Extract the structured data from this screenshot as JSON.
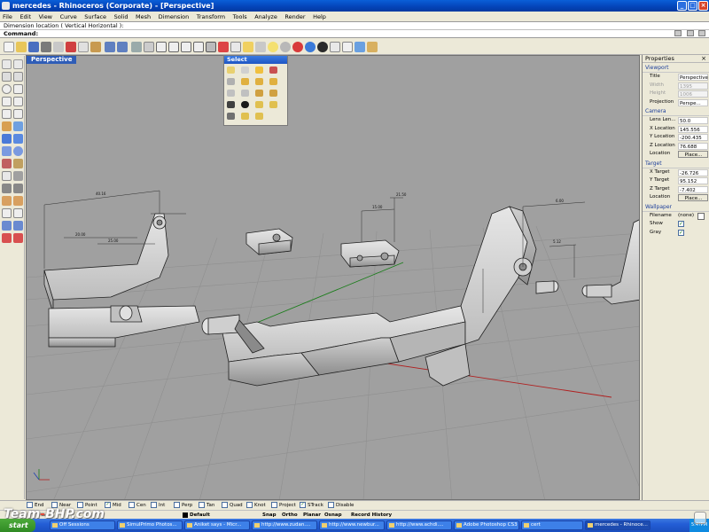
{
  "window": {
    "title": "mercedes - Rhinoceros (Corporate) - [Perspective]",
    "buttons": [
      "_",
      "□",
      "×"
    ]
  },
  "menu": [
    "File",
    "Edit",
    "View",
    "Curve",
    "Surface",
    "Solid",
    "Mesh",
    "Dimension",
    "Transform",
    "Tools",
    "Analyze",
    "Render",
    "Help"
  ],
  "command": {
    "history": "Dimension location ( Vertical  Horizontal ):",
    "prompt": "Command:"
  },
  "viewport": {
    "label": "Perspective",
    "dims": [
      "40.16",
      "20.00",
      "25.00",
      "15.00",
      "21.50",
      "5.12",
      "6.00"
    ]
  },
  "select_panel": {
    "title": "Select"
  },
  "properties": {
    "title": "Properties",
    "sections": {
      "viewport": "Viewport",
      "camera": "Camera",
      "target": "Target",
      "wallpaper": "Wallpaper"
    },
    "viewport_rows": [
      {
        "label": "Title",
        "value": "Perspective"
      },
      {
        "label": "Width",
        "value": "1395"
      },
      {
        "label": "Height",
        "value": "1006"
      },
      {
        "label": "Projection",
        "value": "Perspe..."
      }
    ],
    "camera_rows": [
      {
        "label": "Lens Len...",
        "value": "50.0"
      },
      {
        "label": "X Location",
        "value": "145.556"
      },
      {
        "label": "Y Location",
        "value": "-200.435"
      },
      {
        "label": "Z Location",
        "value": "76.688"
      },
      {
        "label": "Location",
        "value": "Place..."
      }
    ],
    "target_rows": [
      {
        "label": "X Target",
        "value": "-26.726"
      },
      {
        "label": "Y Target",
        "value": "95.152"
      },
      {
        "label": "Z Target",
        "value": "-7.402"
      },
      {
        "label": "Location",
        "value": "Place..."
      }
    ],
    "wallpaper_rows": [
      {
        "label": "Filename",
        "value": "(none)"
      },
      {
        "label": "Show",
        "checked": "✓"
      },
      {
        "label": "Gray",
        "checked": "✓"
      }
    ]
  },
  "osnap": [
    {
      "label": "End",
      "checked": ""
    },
    {
      "label": "Near",
      "checked": ""
    },
    {
      "label": "Point",
      "checked": ""
    },
    {
      "label": "Mid",
      "checked": "✓"
    },
    {
      "label": "Cen",
      "checked": ""
    },
    {
      "label": "Int",
      "checked": ""
    },
    {
      "label": "Perp",
      "checked": ""
    },
    {
      "label": "Tan",
      "checked": ""
    },
    {
      "label": "Quad",
      "checked": ""
    },
    {
      "label": "Knot",
      "checked": ""
    },
    {
      "label": "Project",
      "checked": ""
    },
    {
      "label": "STrack",
      "checked": "✓"
    },
    {
      "label": "Disable",
      "checked": ""
    }
  ],
  "status": {
    "layer": "Default",
    "snap": "Snap",
    "ortho": "Ortho",
    "planar": "Planar",
    "osnap": "Osnap",
    "record": "Record History"
  },
  "taskbar": {
    "start": "start",
    "tasks": [
      "Off Sessions",
      "SimulPrimo Photos...",
      "Aniket says - Micr...",
      "http://www.zudan....",
      "http://www.newbur...",
      "http://www.achdi....",
      "Adobe Photoshop CS3",
      "cert",
      "mercedes - Rhinoce..."
    ],
    "tray": "5:4?PM"
  },
  "watermark": {
    "text_a": "Team",
    "text_b": "BHP",
    "text_c": ".com"
  },
  "colors": {
    "title_bar": "#0443b8",
    "viewport_bg": "#a0a0a0",
    "taskbar": "#245ed6",
    "start": "#2f8a24"
  }
}
